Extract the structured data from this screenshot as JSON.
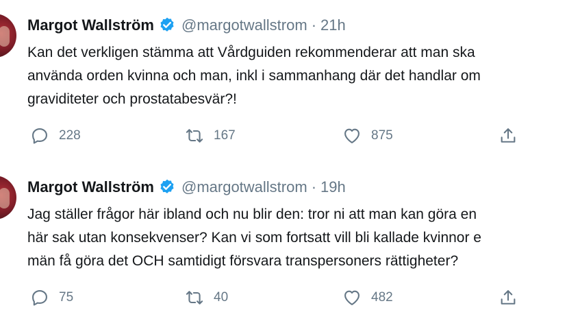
{
  "tweets": [
    {
      "author_name": "Margot Wallström",
      "handle": "@margotwallstrom",
      "separator": "·",
      "time": "21h",
      "text_lines": [
        "Kan det verkligen stämma att Vårdguiden rekommenderar att man ska",
        "använda orden kvinna och man, inkl i sammanhang där det handlar om",
        "graviditeter och prostatabesvär?!"
      ],
      "replies": "228",
      "retweets": "167",
      "likes": "875"
    },
    {
      "author_name": "Margot Wallström",
      "handle": "@margotwallstrom",
      "separator": "·",
      "time": "19h",
      "text_lines": [
        "Jag ställer frågor här ibland och nu blir den: tror ni att man kan göra en",
        "här sak utan konsekvenser? Kan vi som fortsatt vill bli kallade kvinnor e",
        "män få göra det OCH samtidigt försvara transpersoners rättigheter?"
      ],
      "replies": "75",
      "retweets": "40",
      "likes": "482"
    }
  ],
  "icons": {
    "verified": "verified-badge-icon",
    "reply": "reply-icon",
    "retweet": "retweet-icon",
    "like": "heart-icon",
    "share": "share-icon"
  },
  "colors": {
    "verified_blue": "#1da1f2",
    "text": "#14171a",
    "secondary": "#657786"
  }
}
